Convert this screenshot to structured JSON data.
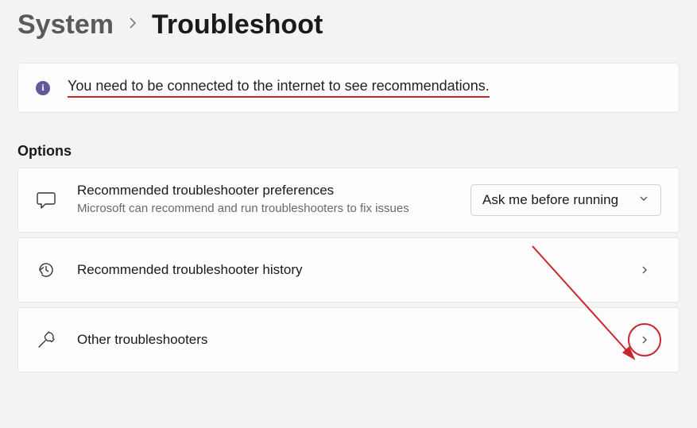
{
  "breadcrumb": {
    "parent": "System",
    "current": "Troubleshoot"
  },
  "alert": {
    "message": "You need to be connected to the internet to see recommendations."
  },
  "section": {
    "title": "Options"
  },
  "rows": {
    "preferences": {
      "title": "Recommended troubleshooter preferences",
      "subtitle": "Microsoft can recommend and run troubleshooters to fix issues",
      "selected": "Ask me before running"
    },
    "history": {
      "title": "Recommended troubleshooter history"
    },
    "other": {
      "title": "Other troubleshooters"
    }
  }
}
